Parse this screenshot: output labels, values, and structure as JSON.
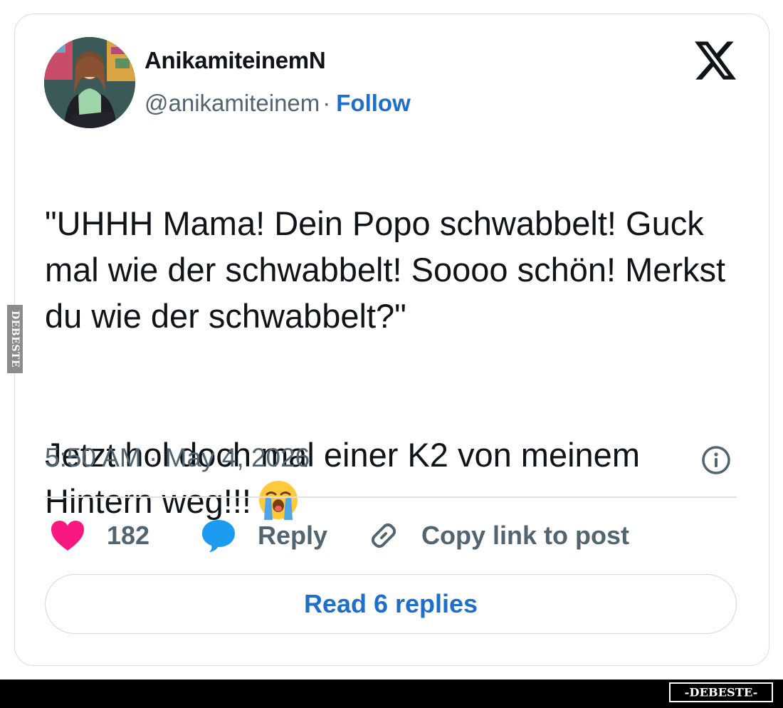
{
  "post": {
    "display_name": "AnikamiteinemN",
    "handle": "@anikamiteinem",
    "separator": "·",
    "follow_label": "Follow",
    "text_paragraph_1": "\"UHHH Mama! Dein Popo schwabbelt! Guck mal wie der schwabbelt! Soooo schön! Merkst du wie der schwabbelt?\"",
    "text_paragraph_2": "Jetzt hol doch mal einer K2 von meinem Hintern weg!!!",
    "emoji": "loudly-crying-face",
    "timestamp": "5:50 AM · May 4, 2026"
  },
  "actions": {
    "like_count": "182",
    "reply_label": "Reply",
    "copy_link_label": "Copy link to post"
  },
  "read_replies_label": "Read 6 replies",
  "watermark": {
    "brand_text": "-DEBESTE-",
    "side_text": "DEBESTE"
  },
  "icons": {
    "platform_logo": "x-logo-icon",
    "info": "info-icon",
    "like": "heart-icon",
    "reply": "speech-bubble-icon",
    "copy": "link-icon"
  },
  "colors": {
    "link_blue": "#1d6fc9",
    "like_pink": "#f91880",
    "reply_blue": "#1d9bf0",
    "secondary_text": "#536471"
  }
}
